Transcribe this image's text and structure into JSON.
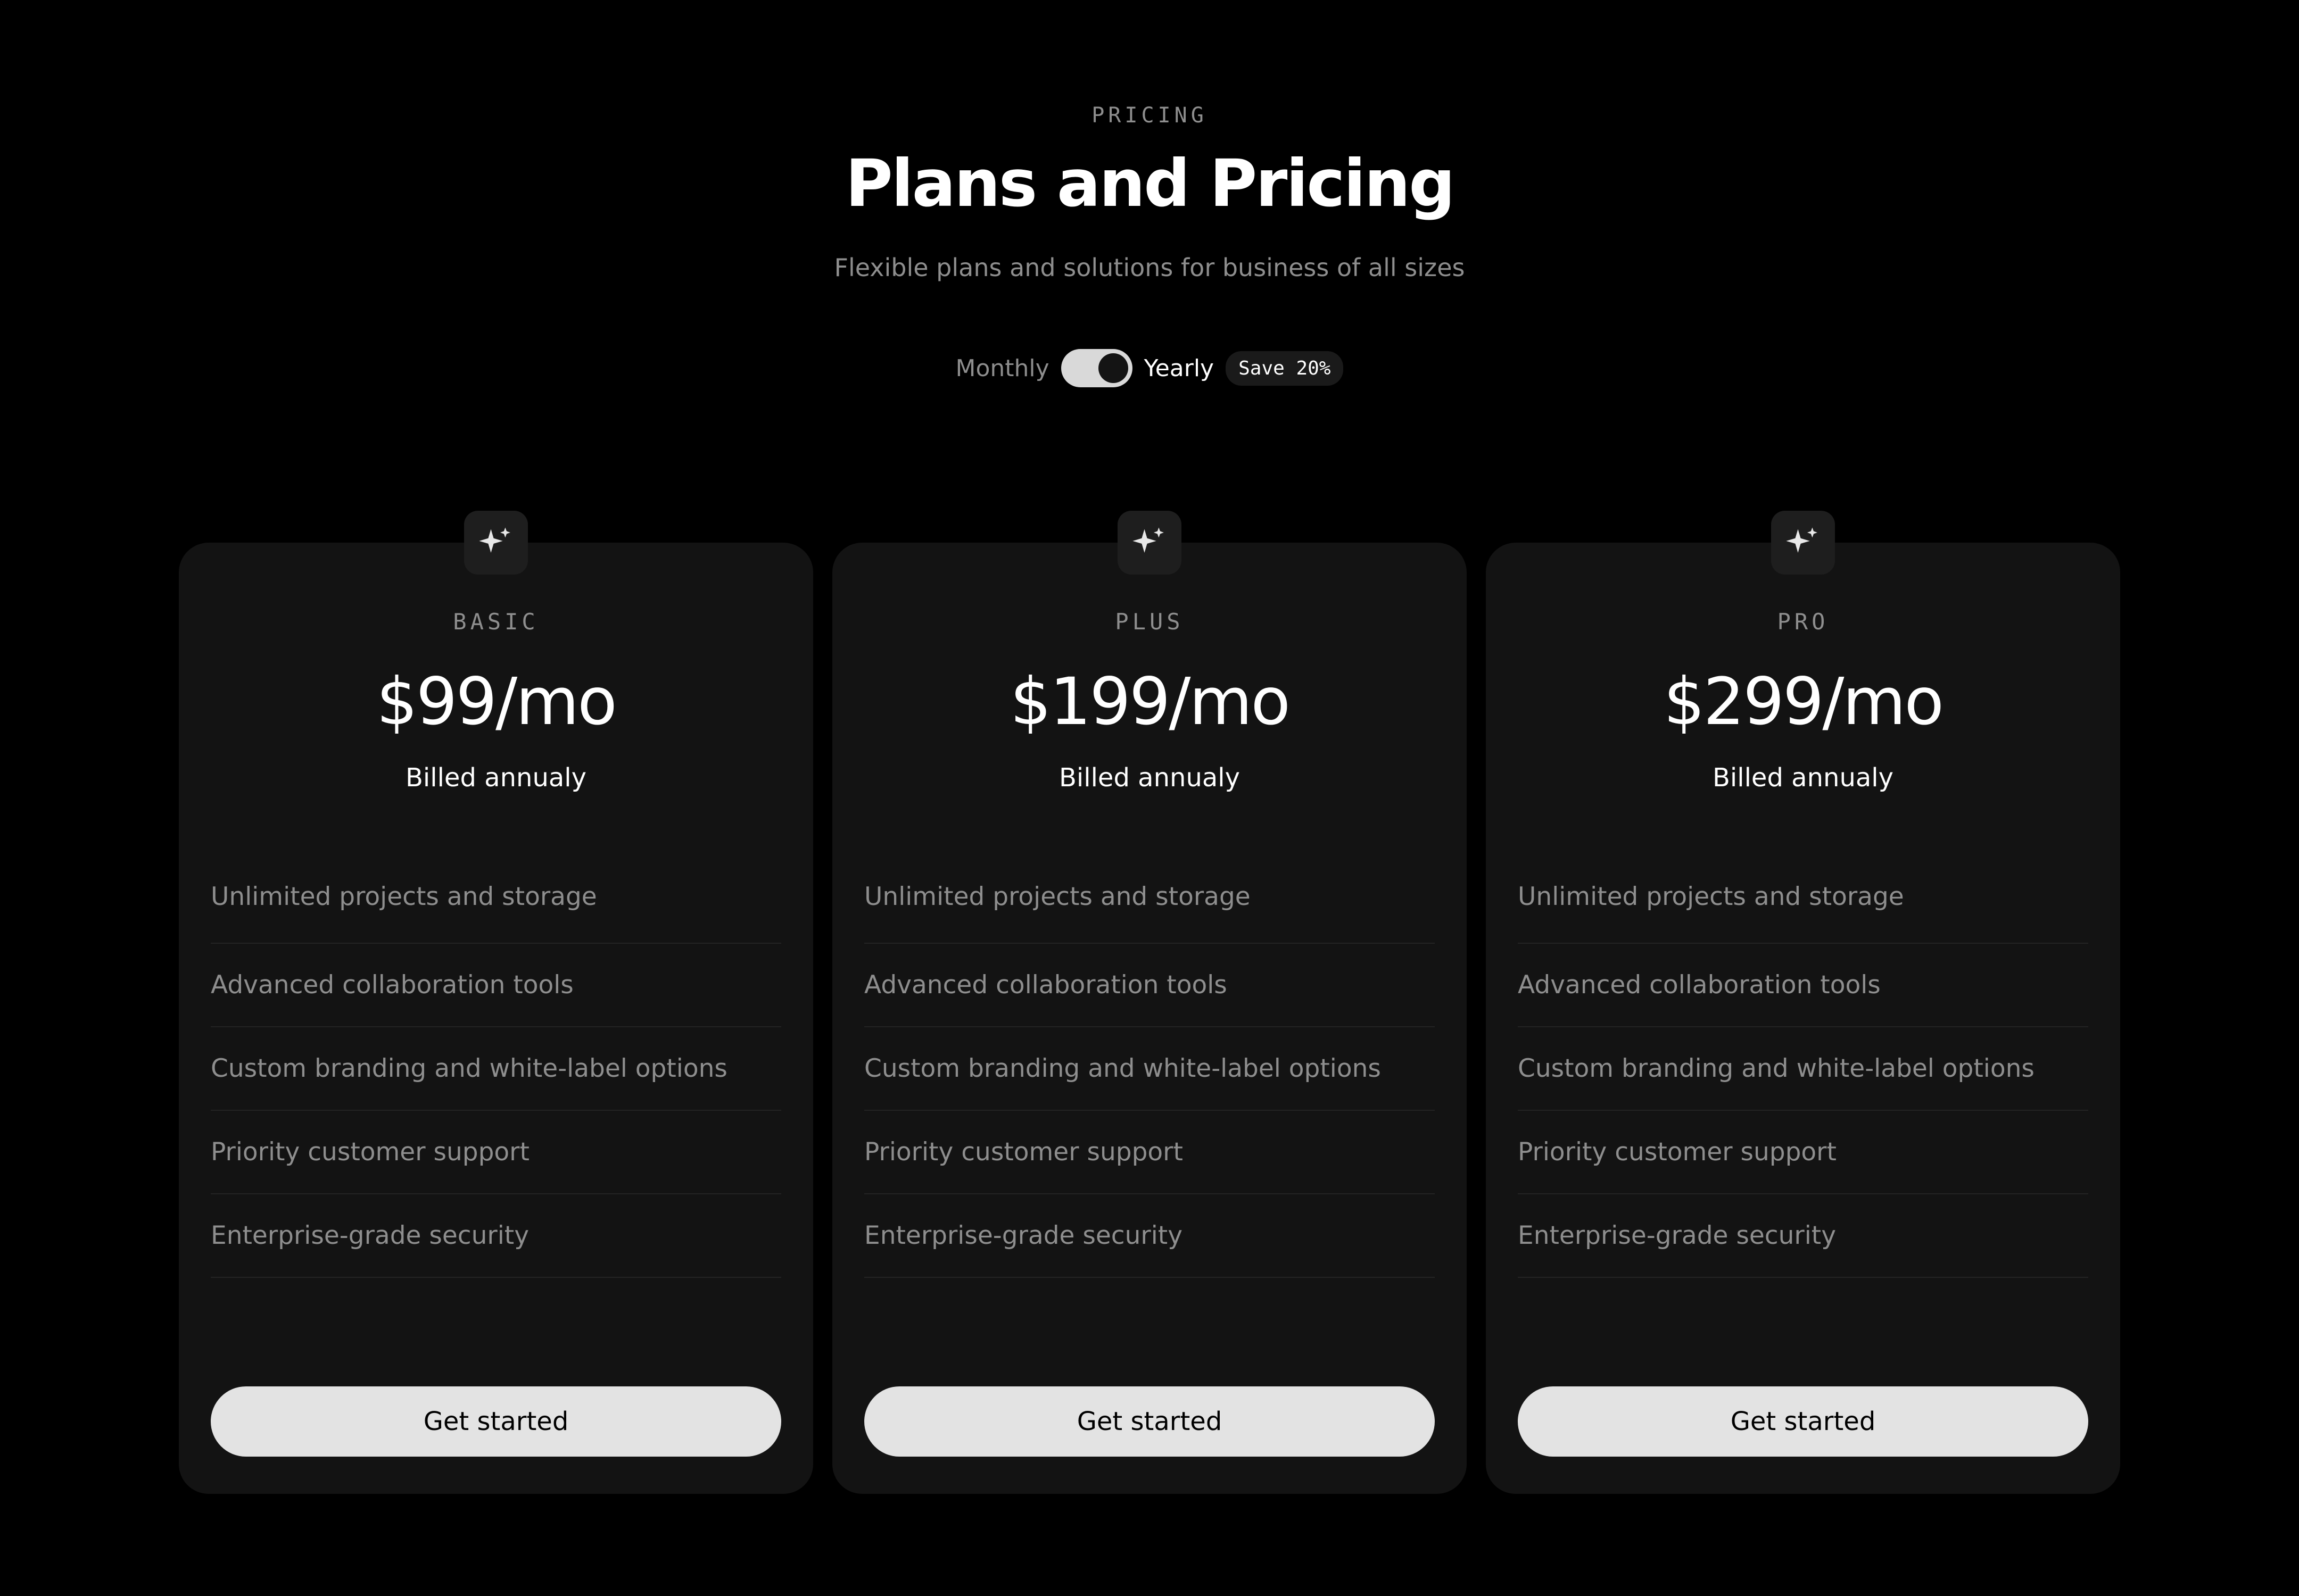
{
  "header": {
    "eyebrow": "PRICING",
    "title": "Plans and Pricing",
    "subtitle": "Flexible plans and solutions for business of all sizes"
  },
  "billing": {
    "monthly_label": "Monthly",
    "yearly_label": "Yearly",
    "badge": "Save 20%",
    "selected": "Yearly"
  },
  "plans": [
    {
      "name": "BASIC",
      "price": "$99/mo",
      "billing": "Billed annualy",
      "icon": "sparkles-icon",
      "features": [
        "Unlimited projects and storage",
        "Advanced collaboration tools",
        "Custom branding and white-label options",
        "Priority customer support",
        "Enterprise-grade security"
      ],
      "cta": "Get started"
    },
    {
      "name": "PLUS",
      "price": "$199/mo",
      "billing": "Billed annualy",
      "icon": "sparkles-icon",
      "features": [
        "Unlimited projects and storage",
        "Advanced collaboration tools",
        "Custom branding and white-label options",
        "Priority customer support",
        "Enterprise-grade security"
      ],
      "cta": "Get started"
    },
    {
      "name": "PRO",
      "price": "$299/mo",
      "billing": "Billed annualy",
      "icon": "sparkles-icon",
      "features": [
        "Unlimited projects and storage",
        "Advanced collaboration tools",
        "Custom branding and white-label options",
        "Priority customer support",
        "Enterprise-grade security"
      ],
      "cta": "Get started"
    }
  ],
  "colors": {
    "background": "#000000",
    "card": "#131313",
    "muted_text": "#8e8e8e",
    "button": "#e3e3e3"
  }
}
